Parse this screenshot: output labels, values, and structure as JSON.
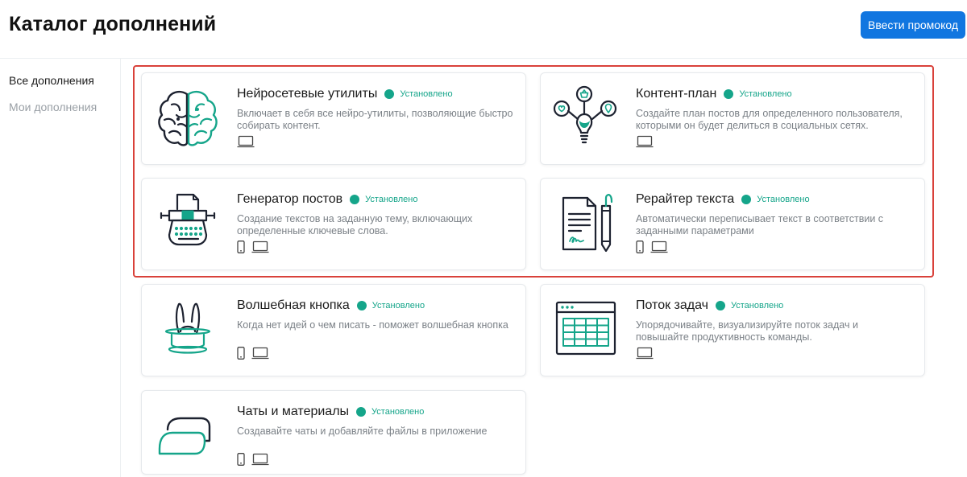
{
  "page": {
    "title": "Каталог дополнений"
  },
  "header": {
    "promo_button": "Ввести промокод"
  },
  "sidebar": {
    "items": [
      {
        "label": "Все дополнения"
      },
      {
        "label": "Мои дополнения"
      }
    ]
  },
  "colors": {
    "accent": "#1176e0",
    "installed": "#15a58a",
    "highlight": "#d9413a",
    "icon_dark": "#1d2230",
    "icon_green": "#15a58a"
  },
  "cards": [
    {
      "title": "Нейросетевые утилиты",
      "status": "Установлено",
      "description": "Включает в себя все нейро-утилиты, позволяющие быстро собирать контент.",
      "icon": "brain-icon",
      "devices": [
        "laptop"
      ]
    },
    {
      "title": "Контент-план",
      "status": "Установлено",
      "description": "Создайте план постов для определенного пользователя, которыми он будет делиться в социальных сетях.",
      "icon": "content-plan-icon",
      "devices": [
        "laptop"
      ]
    },
    {
      "title": "Генератор постов",
      "status": "Установлено",
      "description": "Создание текстов на заданную тему, включающих определенные ключевые слова.",
      "icon": "typewriter-icon",
      "devices": [
        "mobile",
        "laptop"
      ]
    },
    {
      "title": "Рерайтер текста",
      "status": "Установлено",
      "description": "Автоматически переписывает текст в соответствии с заданными параметрами",
      "icon": "document-pen-icon",
      "devices": [
        "mobile",
        "laptop"
      ]
    },
    {
      "title": "Волшебная кнопка",
      "status": "Установлено",
      "description": "Когда нет идей о чем писать - поможет волшебная кнопка",
      "icon": "magic-hat-icon",
      "devices": [
        "mobile",
        "laptop"
      ]
    },
    {
      "title": "Поток задач",
      "status": "Установлено",
      "description": "Упорядочивайте, визуализируйте поток задач и повышайте продуктивность команды.",
      "icon": "task-table-icon",
      "devices": [
        "laptop"
      ]
    },
    {
      "title": "Чаты и материалы",
      "status": "Установлено",
      "description": "Создавайте чаты и добавляйте файлы в приложение",
      "icon": "chat-bubbles-icon",
      "devices": [
        "mobile",
        "laptop"
      ]
    }
  ]
}
